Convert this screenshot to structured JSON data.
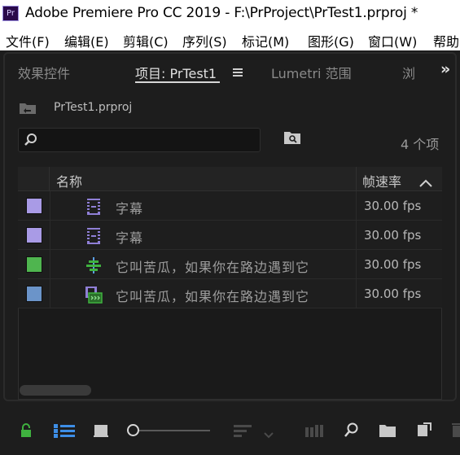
{
  "window": {
    "app_logo_text": "Pr",
    "title": "Adobe Premiere Pro CC 2019 - F:\\PrProject\\PrTest1.prproj *"
  },
  "menu": [
    {
      "label": "文件(F)"
    },
    {
      "label": "编辑(E)"
    },
    {
      "label": "剪辑(C)"
    },
    {
      "label": "序列(S)"
    },
    {
      "label": "标记(M)"
    },
    {
      "label": "图形(G)"
    },
    {
      "label": "窗口(W)"
    },
    {
      "label": "帮助"
    }
  ],
  "tabs": [
    {
      "label": "效果控件",
      "active": false
    },
    {
      "label": "项目: PrTest1",
      "active": true
    },
    {
      "label": "Lumetri 范围",
      "active": false
    },
    {
      "label": "浏",
      "active": false
    }
  ],
  "tab_overflow": "»",
  "project": {
    "name": "PrTest1.prproj",
    "search_value": "",
    "item_count": "4 个项"
  },
  "table": {
    "columns": {
      "name": "名称",
      "fps": "帧速率"
    },
    "rows": [
      {
        "label_color": "#a99be6",
        "icon": "subtitle-icon",
        "name": "字幕",
        "fps": "30.00 fps"
      },
      {
        "label_color": "#a99be6",
        "icon": "subtitle-icon",
        "name": "字幕",
        "fps": "30.00 fps"
      },
      {
        "label_color": "#4fb54f",
        "icon": "audio-clip-icon",
        "name": "它叫苦瓜，如果你在路边遇到它",
        "fps": "30.00 fps"
      },
      {
        "label_color": "#6b94c9",
        "icon": "video-clip-icon",
        "name": "它叫苦瓜，如果你在路边遇到它",
        "fps": "30.00 fps"
      }
    ]
  },
  "colors": {
    "panel_bg": "#1d1d1d",
    "accent_green": "#3fb23f",
    "accent_blue": "#3d8ee6"
  }
}
